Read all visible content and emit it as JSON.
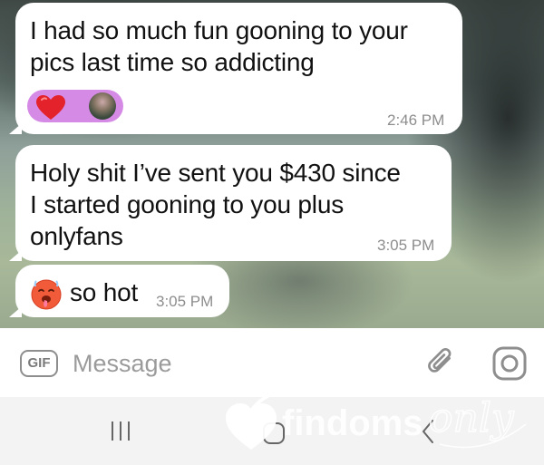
{
  "messages": [
    {
      "text_lines": [
        "I had so much fun gooning to your",
        "pics last time so addicting"
      ],
      "time": "2:46 PM",
      "reactions": [
        "heart-emoji",
        "user-avatar"
      ]
    },
    {
      "text_lines": [
        "Holy shit I’ve sent you $430 since",
        "I started gooning to you plus",
        "onlyfans"
      ],
      "time": "3:05 PM"
    },
    {
      "emoji": "hot-face-emoji",
      "text": "so hot",
      "time": "3:05 PM"
    }
  ],
  "composer": {
    "gif_label": "GIF",
    "placeholder": "Message",
    "attach_icon": "paperclip-icon",
    "camera_icon": "instagram-camera-icon"
  },
  "navbar": {
    "recents_icon": "recent-apps-icon",
    "home_icon": "home-icon",
    "back_icon": "back-icon"
  },
  "watermark": {
    "text_main": "findoms",
    "text_script": "only",
    "logo_icon": "heart-logo-icon"
  },
  "colors": {
    "bubble": "#ffffff",
    "reaction_pill": "#d58be6",
    "heart": "#e3222b",
    "timestamp": "#8d8d8d"
  }
}
